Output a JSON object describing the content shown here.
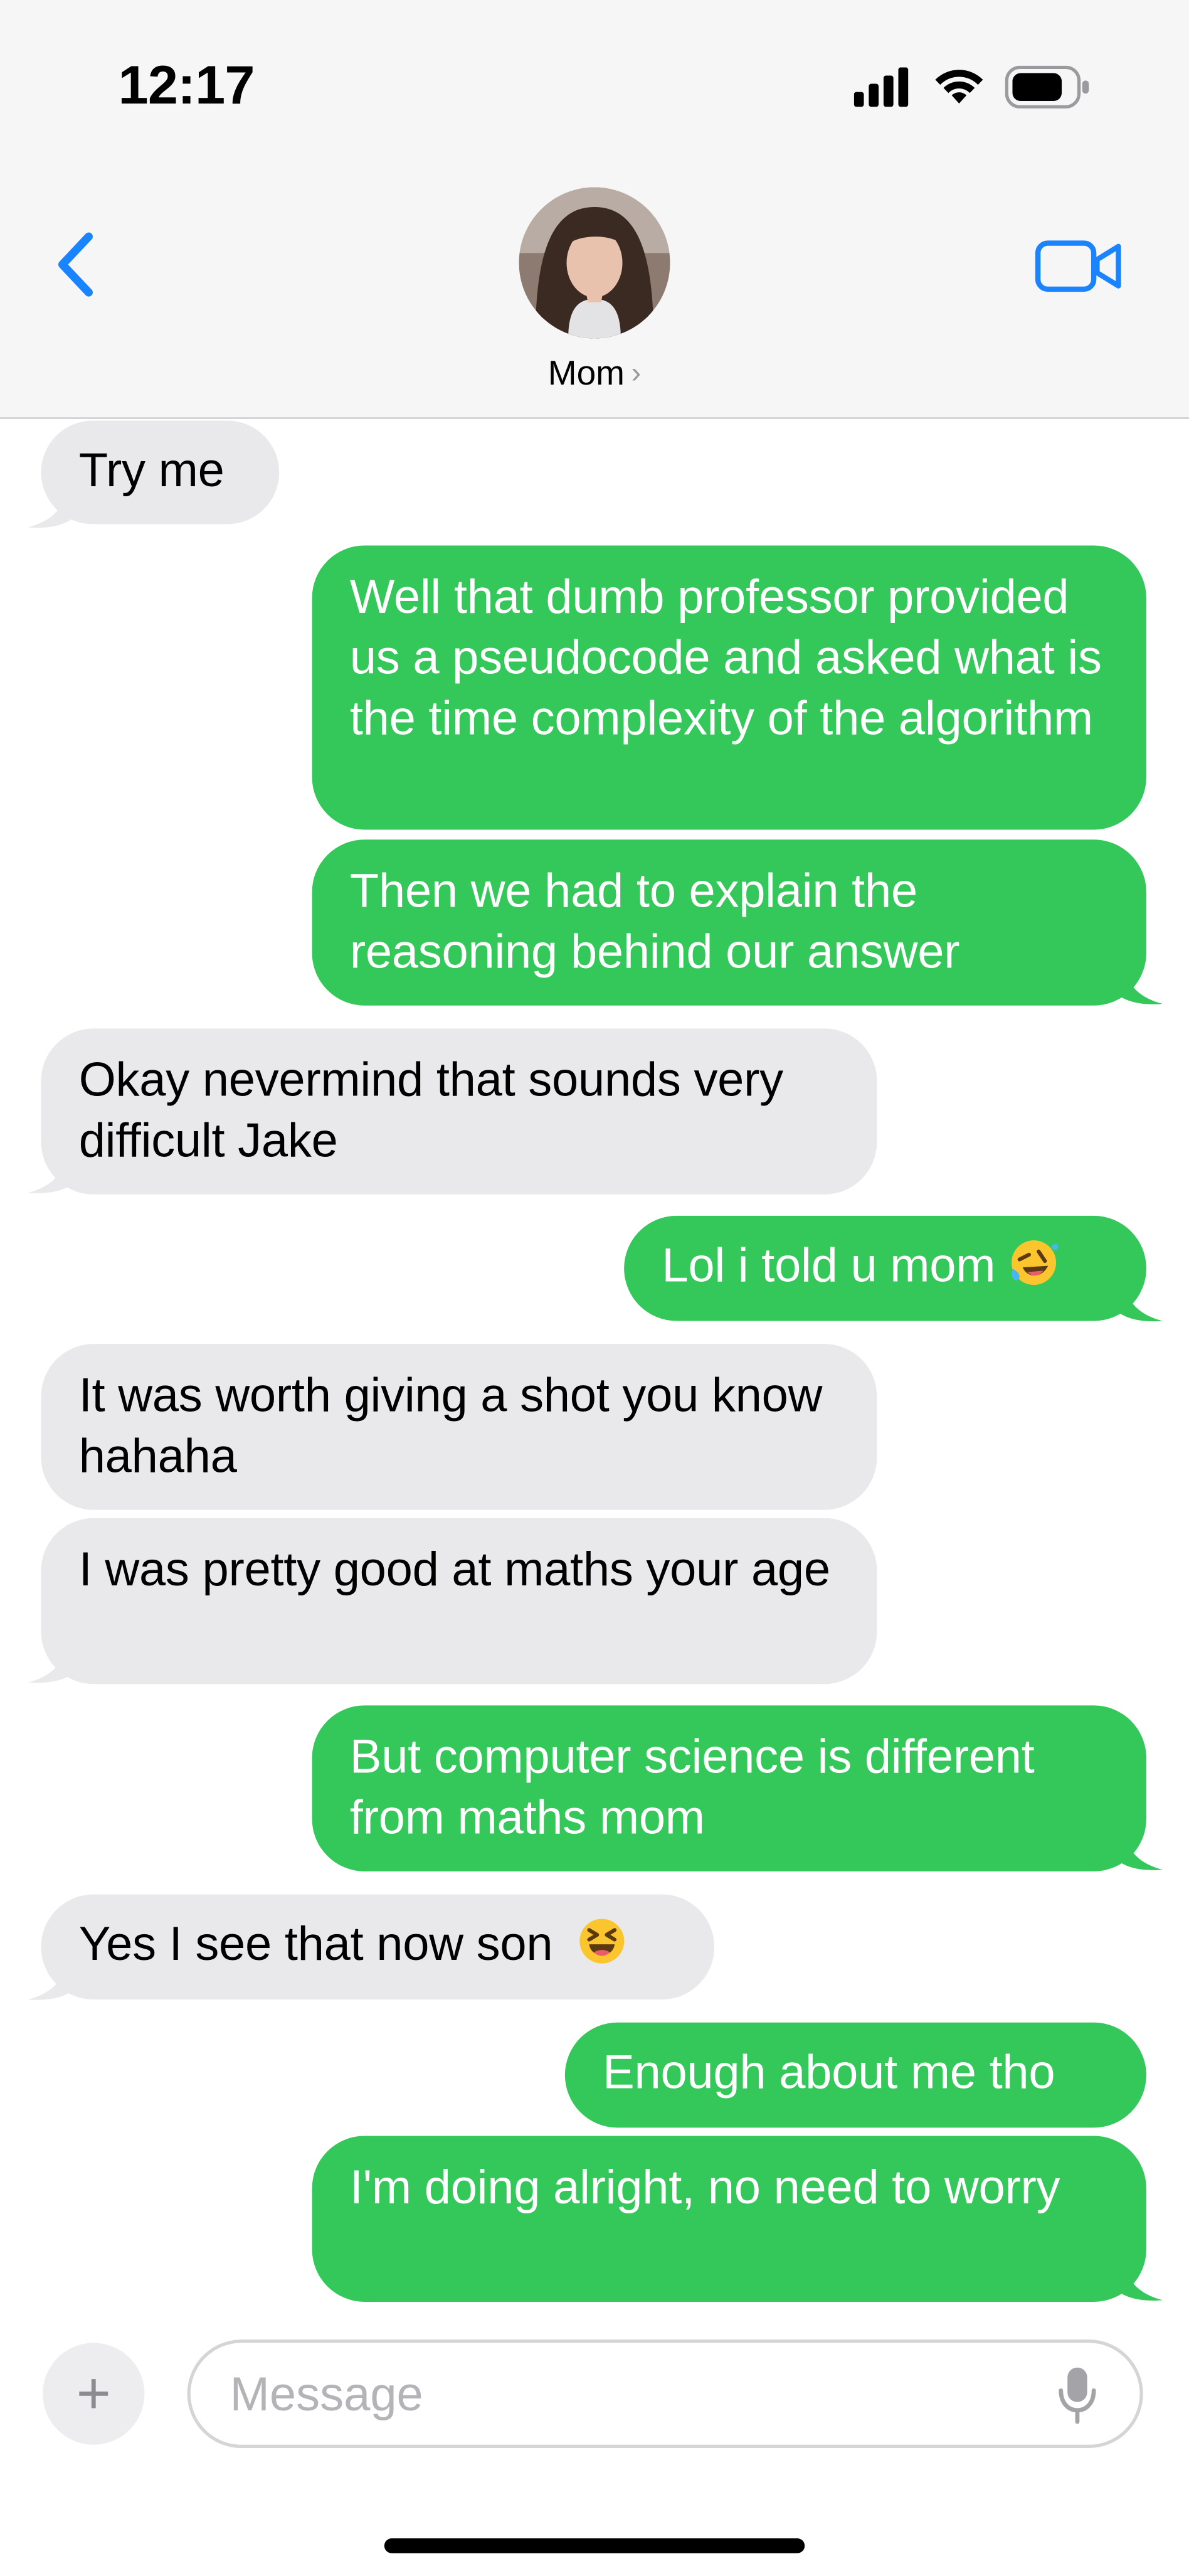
{
  "status_bar": {
    "time": "12:17"
  },
  "header": {
    "contact_name": "Mom",
    "chevron": "›",
    "back_icon": "chevron-left-icon",
    "video_icon": "video-camera-icon"
  },
  "messages": [
    {
      "from": "contact",
      "text": "Try me"
    },
    {
      "from": "me",
      "text": "Well that dumb professor provided us a pseudocode and asked what is the time complexity of the algorithm"
    },
    {
      "from": "me",
      "text": "Then we had to explain the reasoning behind our answer"
    },
    {
      "from": "contact",
      "text": "Okay nevermind that sounds very difficult Jake"
    },
    {
      "from": "me",
      "text": "Lol i told u mom",
      "emoji": "rolling-on-floor-laughing-emoji"
    },
    {
      "from": "contact",
      "text": "It was worth giving a shot you know hahaha"
    },
    {
      "from": "contact",
      "text": "I was pretty good at maths your age"
    },
    {
      "from": "me",
      "text": "But computer science is different from maths mom"
    },
    {
      "from": "contact",
      "text": "Yes I see that now son",
      "emoji": "grinning-squinting-face-emoji"
    },
    {
      "from": "me",
      "text": "Enough about me tho"
    },
    {
      "from": "me",
      "text": "I'm doing alright, no need to worry"
    }
  ],
  "composer": {
    "plus_label": "+",
    "placeholder": "Message",
    "value": ""
  },
  "colors": {
    "outgoing_bubble": "#34c759",
    "incoming_bubble": "#e9e9eb",
    "accent": "#1a84ff"
  }
}
